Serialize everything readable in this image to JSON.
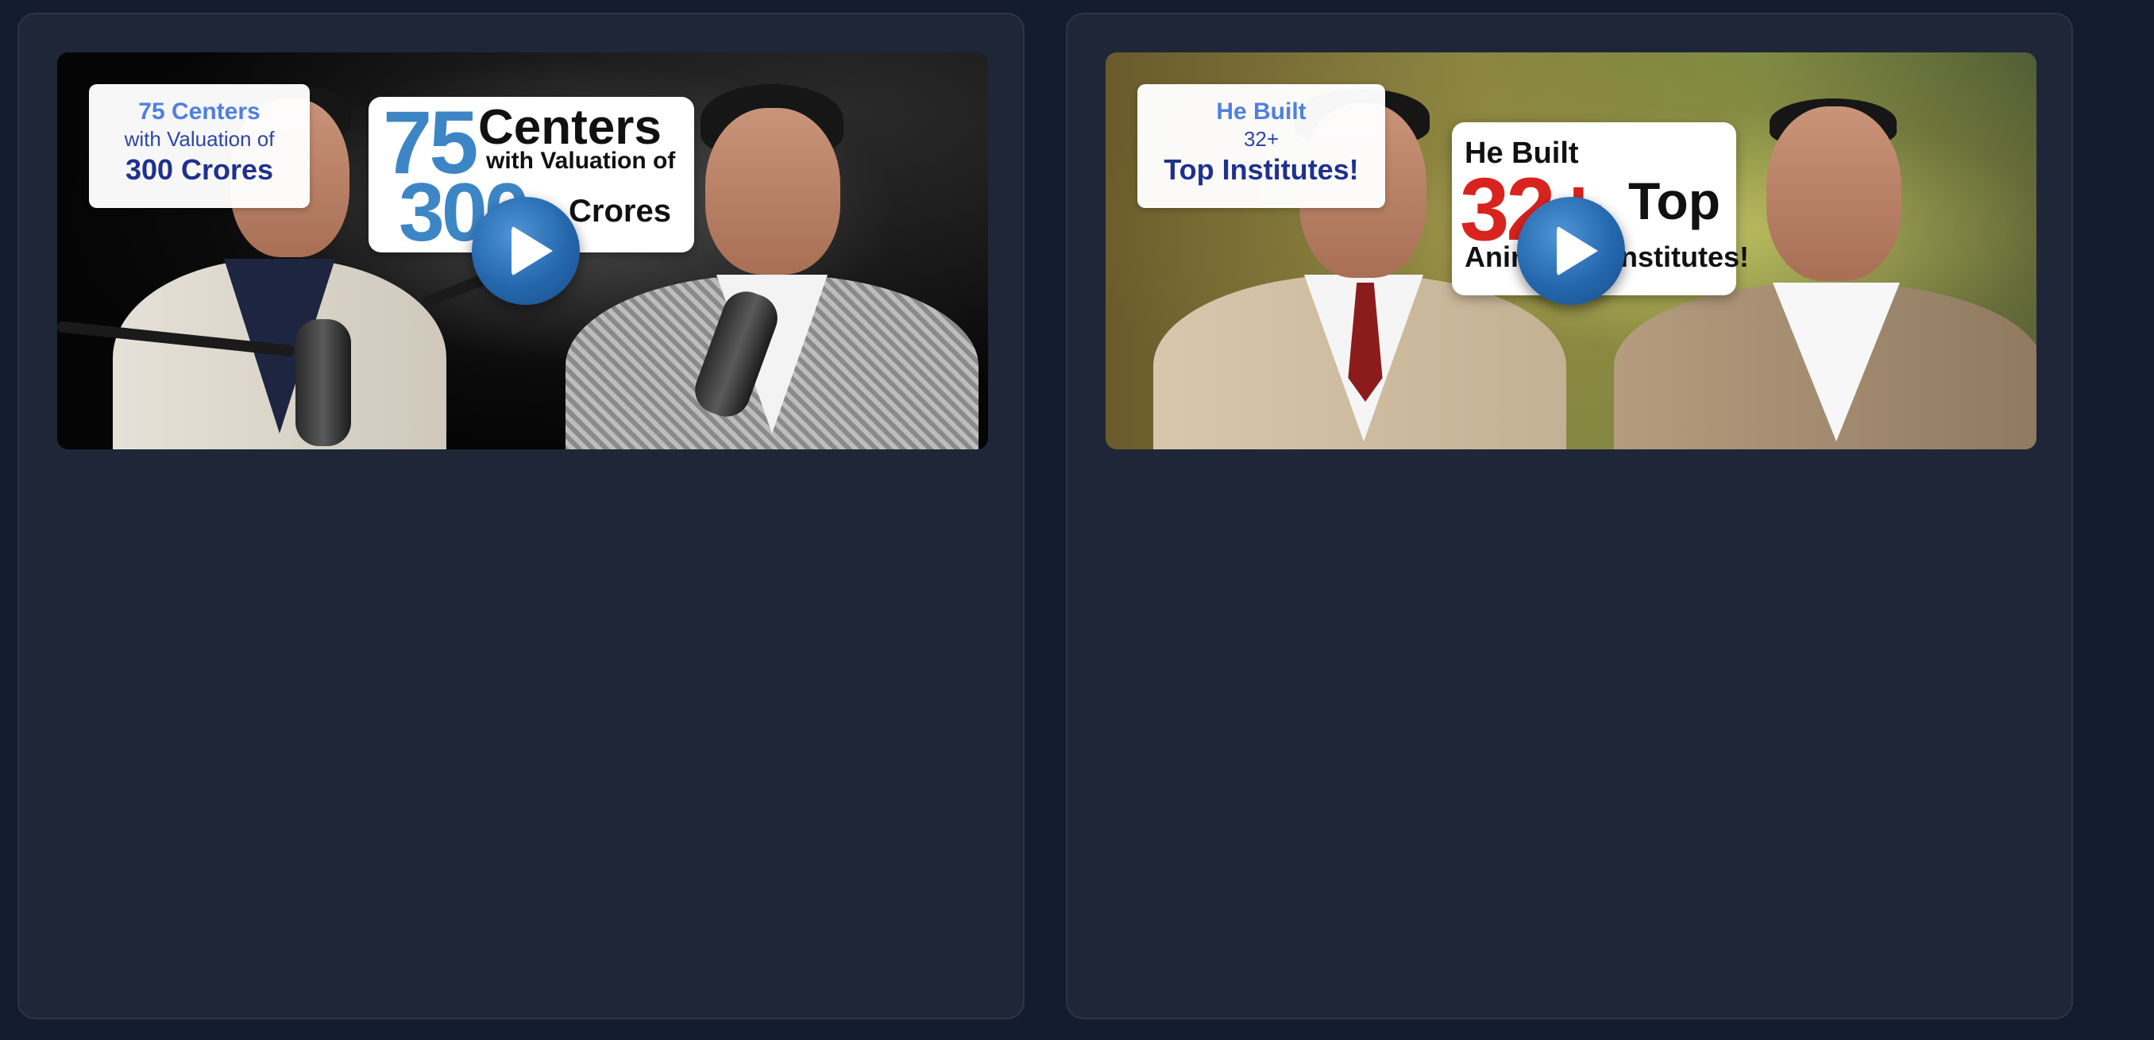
{
  "cards": [
    {
      "label": {
        "line1": "75 Centers",
        "line2": "with Valuation of",
        "line3": "300 Crores"
      },
      "thumbnail_text": {
        "num1": "75",
        "word1": "Centers",
        "small": "with Valuation of",
        "num2": "300",
        "word2": "Crores"
      }
    },
    {
      "label": {
        "line1": "He Built",
        "line2": "32+",
        "line3": "Top Institutes!"
      },
      "thumbnail_text": {
        "top": "He Built",
        "num": "32+",
        "word": "Top",
        "bottom": "Animation Institutes!"
      }
    }
  ],
  "colors": {
    "page_background": "#131b2e",
    "card_background": "#1f2637",
    "label_line1": "#4f80e0",
    "label_line2": "#2e46a8",
    "label_line3": "#1f318f",
    "play_button": "#2467ad",
    "accent_red": "#d9231f"
  }
}
